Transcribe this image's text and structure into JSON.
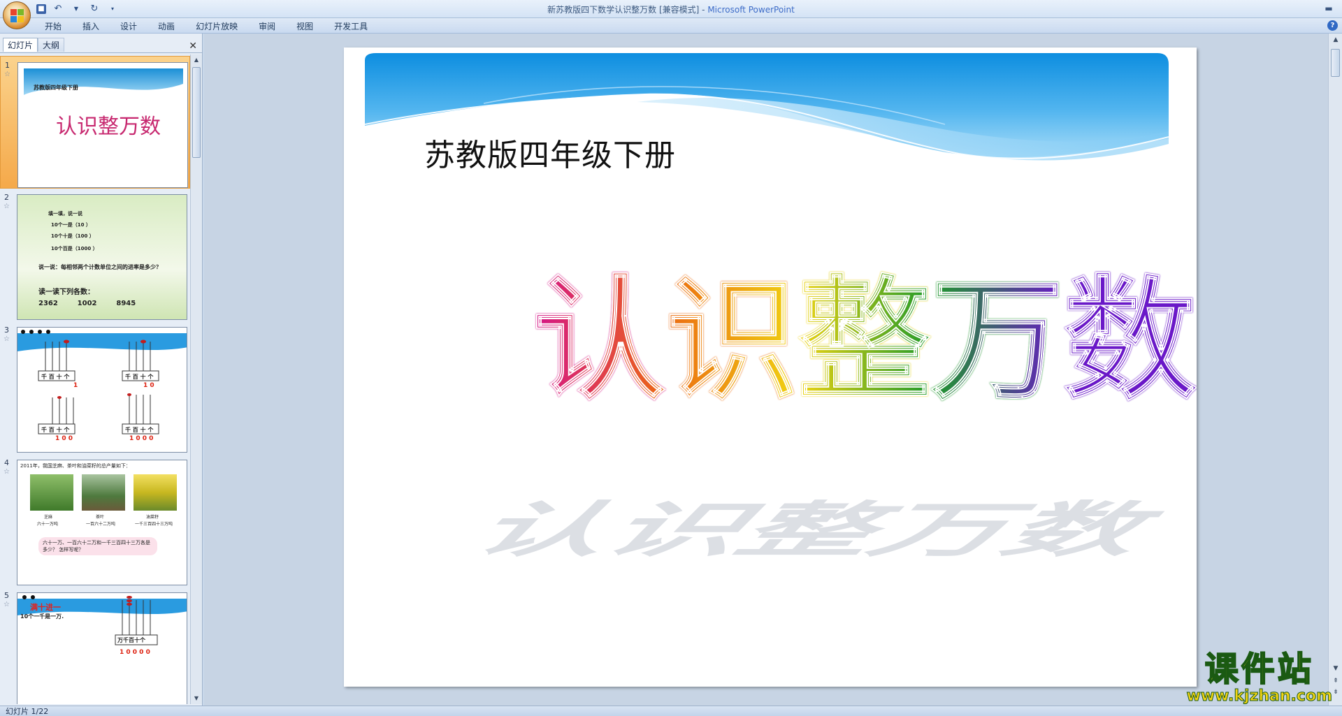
{
  "window": {
    "title_doc": "新苏教版四下数学认识整万数 [兼容模式]",
    "title_sep": " - ",
    "title_app": "Microsoft PowerPoint"
  },
  "qat": {
    "save_icon": "save-icon",
    "undo_icon": "undo-icon",
    "redo_icon": "redo-icon",
    "customize_icon": "dropdown-icon"
  },
  "ribbon": {
    "tabs": [
      "开始",
      "插入",
      "设计",
      "动画",
      "幻灯片放映",
      "审阅",
      "视图",
      "开发工具"
    ]
  },
  "panel": {
    "tab_slides": "幻灯片",
    "tab_outline": "大纲",
    "close": "✕"
  },
  "thumbnails": [
    {
      "num": "1",
      "title": "苏教版四年级下册",
      "big": "认识整万数"
    },
    {
      "num": "2",
      "line1": "填一填，说一说",
      "line2": "10个一是（10  ）",
      "line3": "10个十是（100 ）",
      "line4": "10个百是（1000    ）",
      "q": "说一说：每相邻两个计数单位之间的进率是多少？",
      "read": "读一读下列各数：",
      "nums": "2362        1002        8945"
    },
    {
      "num": "3",
      "label": "千 百 十 个",
      "v1": "1",
      "v2": "1 0",
      "v3": "1 0 0",
      "v4": "1 0 0 0"
    },
    {
      "num": "4",
      "head": "2011年，我国芝麻、茶叶和油菜籽的总产量如下：",
      "c1": "芝麻",
      "c1b": "六十一万吨",
      "c2": "茶叶",
      "c2b": "一百六十二万吨",
      "c3": "油菜籽",
      "c3b": "一千三百四十三万吨",
      "bubble": "六十一万、一百六十二万和一千三百四十三万各是多少？ 怎样写呢？"
    },
    {
      "num": "5",
      "red": "满十进一",
      "rule": "10个一千是一万.",
      "label": "万千百十个",
      "value": "1 0 0 0 0"
    }
  ],
  "slide": {
    "subtitle": "苏教版四年级下册",
    "title_chars": [
      "认",
      "识",
      "整",
      "万",
      "数"
    ],
    "title_colors": [
      "#d4148a",
      "#ec6a12",
      "#f0d412",
      "#1e9a2a",
      "#6a18c8"
    ]
  },
  "status": {
    "slide_info": "幻灯片 1/22"
  },
  "watermark": {
    "main": "课件站",
    "url": "www.kjzhan.com"
  }
}
